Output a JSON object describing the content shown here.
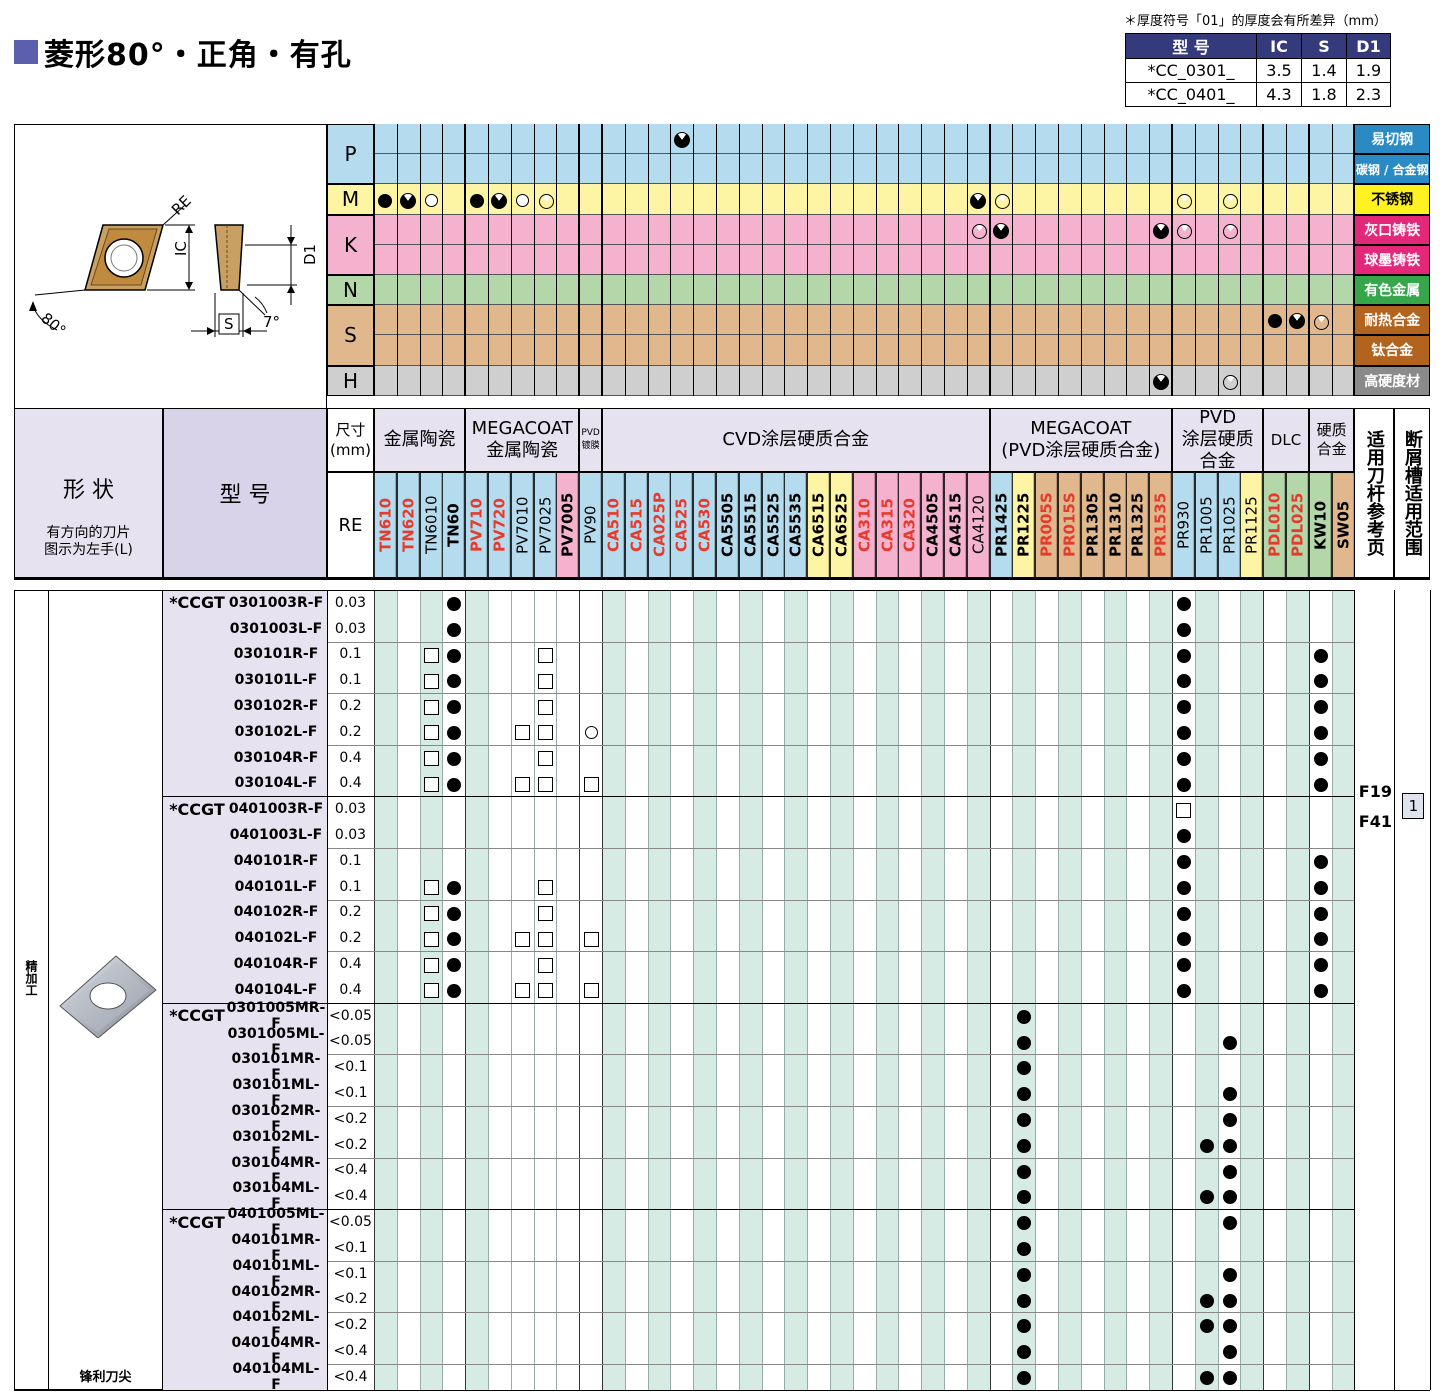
{
  "title": "菱形80°・正角・有孔",
  "note": "＊厚度符号「01」的厚度会有所差异（mm）",
  "dims_table": {
    "headers": [
      "型 号",
      "IC",
      "S",
      "D1"
    ],
    "rows": [
      [
        "*CC_0301_",
        "3.5",
        "1.4",
        "1.9"
      ],
      [
        "*CC_0401_",
        "4.3",
        "1.8",
        "2.3"
      ]
    ]
  },
  "diagram_labels": {
    "re": "RE",
    "ic": "IC",
    "d1": "D1",
    "s": "S",
    "angle80": "80°",
    "angle7": "7°"
  },
  "materials": [
    {
      "code": "P",
      "color": "#b5dcee",
      "rows": [
        {
          "name": "易切钢",
          "bg": "#2a8ac4"
        },
        {
          "name": "碳钢 / 合金钢",
          "bg": "#2a8ac4"
        }
      ]
    },
    {
      "code": "M",
      "color": "#fdf5a4",
      "rows": [
        {
          "name": "不锈钢",
          "bg": "#fff220"
        }
      ]
    },
    {
      "code": "K",
      "color": "#f4b2cf",
      "rows": [
        {
          "name": "灰口铸铁",
          "bg": "#e3287a"
        },
        {
          "name": "球墨铸铁",
          "bg": "#e3287a"
        }
      ]
    },
    {
      "code": "N",
      "color": "#b4d7aa",
      "rows": [
        {
          "name": "有色金属",
          "bg": "#36a64a"
        }
      ]
    },
    {
      "code": "S",
      "color": "#e1b88e",
      "rows": [
        {
          "name": "耐热合金",
          "bg": "#b2641f"
        },
        {
          "name": "钛合金",
          "bg": "#b2641f"
        }
      ]
    },
    {
      "code": "H",
      "color": "#cfcfcf",
      "rows": [
        {
          "name": "高硬度材",
          "bg": "#8a8a8a"
        }
      ]
    }
  ],
  "material_marks": [
    [
      [
        [
          "N",
          "pac"
        ]
      ]
    ],
    [
      [
        [
          "A",
          "dot"
        ],
        [
          "B",
          "pac"
        ],
        [
          "C",
          "circle"
        ],
        [
          "E",
          "dot"
        ],
        [
          "F",
          "pac"
        ],
        [
          "G",
          "circle"
        ],
        [
          "H",
          "thin"
        ],
        [
          "AA",
          "pac"
        ],
        [
          "AB",
          "thin"
        ],
        [
          "AJ",
          "thin"
        ],
        [
          "AL",
          "thin"
        ]
      ]
    ],
    [
      [
        [
          "AA",
          "thin"
        ],
        [
          "AB",
          "pac"
        ],
        [
          "AI",
          "pac"
        ],
        [
          "AJ",
          "thin"
        ],
        [
          "AL",
          "thin"
        ]
      ]
    ],
    [
      [],
      []
    ],
    [
      [
        [
          "AN",
          "dot"
        ],
        [
          "AO",
          "pac"
        ],
        [
          "AP",
          "thin"
        ]
      ]
    ],
    [
      [
        [
          "AI",
          "pac"
        ],
        [
          "AL",
          "thin"
        ]
      ],
      [
        [
          "AI",
          "pac"
        ],
        [
          "AP",
          "thin"
        ]
      ]
    ],
    [
      []
    ]
  ],
  "headers": {
    "shape": "形 状",
    "shape_note": "有方向的刀片\n图示为左手(L)",
    "model": "型 号",
    "size": "尺寸\n(mm)",
    "re": "RE",
    "holder_pages": "适用刀杆参考页",
    "breaker_range": "断屑槽适用范围"
  },
  "groups": [
    {
      "label": "金属陶瓷",
      "cols": 4
    },
    {
      "label": "MEGACOAT\n金属陶瓷",
      "cols": 5
    },
    {
      "label": "PVD\n镀膜",
      "cols": 1
    },
    {
      "label": "CVD涂层硬质合金",
      "cols": 17
    },
    {
      "label": "MEGACOAT\n(PVD涂层硬质合金)",
      "cols": 8
    },
    {
      "label": "PVD\n涂层硬质合金",
      "cols": 4
    },
    {
      "label": "DLC",
      "cols": 2
    },
    {
      "label": "硬质\n合金",
      "cols": 2
    }
  ],
  "grades": [
    {
      "name": "TN610",
      "color": "#e63a2c",
      "bg": "#b5dcee"
    },
    {
      "name": "TN620",
      "color": "#e63a2c",
      "bg": "#b5dcee"
    },
    {
      "name": "TN6010",
      "color": "#000",
      "bg": "#b5dcee",
      "normal": true
    },
    {
      "name": "TN60",
      "color": "#000",
      "bg": "#b5dcee"
    },
    {
      "name": "PV710",
      "color": "#e63a2c",
      "bg": "#b5dcee"
    },
    {
      "name": "PV720",
      "color": "#e63a2c",
      "bg": "#b5dcee"
    },
    {
      "name": "PV7010",
      "color": "#000",
      "bg": "#b5dcee",
      "normal": true
    },
    {
      "name": "PV7025",
      "color": "#000",
      "bg": "#b5dcee",
      "normal": true
    },
    {
      "name": "PV7005",
      "color": "#000",
      "bg": "#f4b2cf"
    },
    {
      "name": "PV90",
      "color": "#000",
      "bg": "#b5dcee",
      "normal": true
    },
    {
      "name": "CA510",
      "color": "#e63a2c",
      "bg": "#b5dcee"
    },
    {
      "name": "CA515",
      "color": "#e63a2c",
      "bg": "#b5dcee"
    },
    {
      "name": "CA025P",
      "color": "#e63a2c",
      "bg": "#b5dcee"
    },
    {
      "name": "CA525",
      "color": "#e63a2c",
      "bg": "#b5dcee"
    },
    {
      "name": "CA530",
      "color": "#e63a2c",
      "bg": "#b5dcee"
    },
    {
      "name": "CA5505",
      "color": "#000",
      "bg": "#b5dcee"
    },
    {
      "name": "CA5515",
      "color": "#000",
      "bg": "#b5dcee"
    },
    {
      "name": "CA5525",
      "color": "#000",
      "bg": "#b5dcee"
    },
    {
      "name": "CA5535",
      "color": "#000",
      "bg": "#b5dcee"
    },
    {
      "name": "CA6515",
      "color": "#000",
      "bg": "#fdf5a4"
    },
    {
      "name": "CA6525",
      "color": "#000",
      "bg": "#fdf5a4"
    },
    {
      "name": "CA310",
      "color": "#e63a2c",
      "bg": "#f4b2cf"
    },
    {
      "name": "CA315",
      "color": "#e63a2c",
      "bg": "#f4b2cf"
    },
    {
      "name": "CA320",
      "color": "#e63a2c",
      "bg": "#f4b2cf"
    },
    {
      "name": "CA4505",
      "color": "#000",
      "bg": "#f4b2cf"
    },
    {
      "name": "CA4515",
      "color": "#000",
      "bg": "#f4b2cf"
    },
    {
      "name": "CA4120",
      "color": "#000",
      "bg": "#f4b2cf",
      "normal": true
    },
    {
      "name": "PR1425",
      "color": "#000",
      "bg": "#b5dcee"
    },
    {
      "name": "PR1225",
      "color": "#000",
      "bg": "#fdf5a4"
    },
    {
      "name": "PR005S",
      "color": "#e63a2c",
      "bg": "#e1b88e"
    },
    {
      "name": "PR015S",
      "color": "#e63a2c",
      "bg": "#e1b88e"
    },
    {
      "name": "PR1305",
      "color": "#000",
      "bg": "#e1b88e"
    },
    {
      "name": "PR1310",
      "color": "#000",
      "bg": "#e1b88e"
    },
    {
      "name": "PR1325",
      "color": "#000",
      "bg": "#e1b88e"
    },
    {
      "name": "PR1535",
      "color": "#e63a2c",
      "bg": "#e1b88e"
    },
    {
      "name": "PR930",
      "color": "#000",
      "bg": "#b5dcee",
      "normal": true
    },
    {
      "name": "PR1005",
      "color": "#000",
      "bg": "#b5dcee",
      "normal": true
    },
    {
      "name": "PR1025",
      "color": "#000",
      "bg": "#b5dcee",
      "normal": true
    },
    {
      "name": "PR1125",
      "color": "#000",
      "bg": "#fdf5a4",
      "normal": true
    },
    {
      "name": "PDL010",
      "color": "#e63a2c",
      "bg": "#b4d7aa"
    },
    {
      "name": "PDL025",
      "color": "#e63a2c",
      "bg": "#b4d7aa"
    },
    {
      "name": "KW10",
      "color": "#000",
      "bg": "#b4d7aa"
    },
    {
      "name": "SW05",
      "color": "#000",
      "bg": "#e1b88e"
    }
  ],
  "body": {
    "category": "精加工",
    "shape_caption": "锋利刀尖",
    "holder_pages": [
      "F19",
      "F41"
    ],
    "breaker_range": "1",
    "rows": [
      {
        "prefix": "*CCGT",
        "model": "0301003R-F",
        "re": "0.03",
        "marks": [
          [
            "D",
            "dot"
          ],
          [
            "AJ",
            "dot"
          ]
        ]
      },
      {
        "model": "0301003L-F",
        "re": "0.03",
        "marks": [
          [
            "D",
            "dot"
          ],
          [
            "AJ",
            "dot"
          ]
        ]
      },
      {
        "model": "030101R-F",
        "re": "0.1",
        "marks": [
          [
            "C",
            "square"
          ],
          [
            "D",
            "dot"
          ],
          [
            "H",
            "square"
          ],
          [
            "AJ",
            "dot"
          ],
          [
            "AP",
            "dot"
          ]
        ]
      },
      {
        "model": "030101L-F",
        "re": "0.1",
        "marks": [
          [
            "C",
            "square"
          ],
          [
            "D",
            "dot"
          ],
          [
            "H",
            "square"
          ],
          [
            "AJ",
            "dot"
          ],
          [
            "AP",
            "dot"
          ]
        ]
      },
      {
        "model": "030102R-F",
        "re": "0.2",
        "marks": [
          [
            "C",
            "square"
          ],
          [
            "D",
            "dot"
          ],
          [
            "H",
            "square"
          ],
          [
            "AJ",
            "dot"
          ],
          [
            "AP",
            "dot"
          ]
        ]
      },
      {
        "model": "030102L-F",
        "re": "0.2",
        "marks": [
          [
            "C",
            "square"
          ],
          [
            "D",
            "dot"
          ],
          [
            "G",
            "square"
          ],
          [
            "H",
            "square"
          ],
          [
            "J",
            "circle"
          ],
          [
            "AJ",
            "dot"
          ],
          [
            "AP",
            "dot"
          ]
        ]
      },
      {
        "model": "030104R-F",
        "re": "0.4",
        "marks": [
          [
            "C",
            "square"
          ],
          [
            "D",
            "dot"
          ],
          [
            "H",
            "square"
          ],
          [
            "AJ",
            "dot"
          ],
          [
            "AP",
            "dot"
          ]
        ]
      },
      {
        "model": "030104L-F",
        "re": "0.4",
        "marks": [
          [
            "C",
            "square"
          ],
          [
            "D",
            "dot"
          ],
          [
            "G",
            "square"
          ],
          [
            "H",
            "square"
          ],
          [
            "J",
            "square"
          ],
          [
            "AJ",
            "dot"
          ],
          [
            "AP",
            "dot"
          ]
        ]
      },
      {
        "prefix": "*CCGT",
        "model": "0401003R-F",
        "re": "0.03",
        "marks": [
          [
            "AJ",
            "square"
          ]
        ]
      },
      {
        "model": "0401003L-F",
        "re": "0.03",
        "marks": [
          [
            "AJ",
            "dot"
          ]
        ]
      },
      {
        "model": "040101R-F",
        "re": "0.1",
        "marks": [
          [
            "AJ",
            "dot"
          ],
          [
            "AP",
            "dot"
          ]
        ]
      },
      {
        "model": "040101L-F",
        "re": "0.1",
        "marks": [
          [
            "C",
            "square"
          ],
          [
            "D",
            "dot"
          ],
          [
            "H",
            "square"
          ],
          [
            "AJ",
            "dot"
          ],
          [
            "AP",
            "dot"
          ]
        ]
      },
      {
        "model": "040102R-F",
        "re": "0.2",
        "marks": [
          [
            "C",
            "square"
          ],
          [
            "D",
            "dot"
          ],
          [
            "H",
            "square"
          ],
          [
            "AJ",
            "dot"
          ],
          [
            "AP",
            "dot"
          ]
        ]
      },
      {
        "model": "040102L-F",
        "re": "0.2",
        "marks": [
          [
            "C",
            "square"
          ],
          [
            "D",
            "dot"
          ],
          [
            "G",
            "square"
          ],
          [
            "H",
            "square"
          ],
          [
            "J",
            "square"
          ],
          [
            "AJ",
            "dot"
          ],
          [
            "AP",
            "dot"
          ]
        ]
      },
      {
        "model": "040104R-F",
        "re": "0.4",
        "marks": [
          [
            "C",
            "square"
          ],
          [
            "D",
            "dot"
          ],
          [
            "H",
            "square"
          ],
          [
            "AJ",
            "dot"
          ],
          [
            "AP",
            "dot"
          ]
        ]
      },
      {
        "model": "040104L-F",
        "re": "0.4",
        "marks": [
          [
            "C",
            "square"
          ],
          [
            "D",
            "dot"
          ],
          [
            "G",
            "square"
          ],
          [
            "H",
            "square"
          ],
          [
            "J",
            "square"
          ],
          [
            "AJ",
            "dot"
          ],
          [
            "AP",
            "dot"
          ]
        ]
      },
      {
        "prefix": "*CCGT",
        "model": "0301005MR-F",
        "re": "<0.05",
        "marks": [
          [
            "AC",
            "dot"
          ]
        ]
      },
      {
        "model": "0301005ML-F",
        "re": "<0.05",
        "marks": [
          [
            "AC",
            "dot"
          ],
          [
            "AL",
            "dot"
          ]
        ]
      },
      {
        "model": "030101MR-F",
        "re": "<0.1",
        "marks": [
          [
            "AC",
            "dot"
          ]
        ]
      },
      {
        "model": "030101ML-F",
        "re": "<0.1",
        "marks": [
          [
            "AC",
            "dot"
          ],
          [
            "AL",
            "dot"
          ]
        ]
      },
      {
        "model": "030102MR-F",
        "re": "<0.2",
        "marks": [
          [
            "AC",
            "dot"
          ],
          [
            "AL",
            "dot"
          ]
        ]
      },
      {
        "model": "030102ML-F",
        "re": "<0.2",
        "marks": [
          [
            "AC",
            "dot"
          ],
          [
            "AK",
            "dot"
          ],
          [
            "AL",
            "dot"
          ]
        ]
      },
      {
        "model": "030104MR-F",
        "re": "<0.4",
        "marks": [
          [
            "AC",
            "dot"
          ],
          [
            "AL",
            "dot"
          ]
        ]
      },
      {
        "model": "030104ML-F",
        "re": "<0.4",
        "marks": [
          [
            "AC",
            "dot"
          ],
          [
            "AK",
            "dot"
          ],
          [
            "AL",
            "dot"
          ]
        ]
      },
      {
        "prefix": "*CCGT",
        "model": "0401005ML-F",
        "re": "<0.05",
        "marks": [
          [
            "AC",
            "dot"
          ],
          [
            "AL",
            "dot"
          ]
        ]
      },
      {
        "model": "040101MR-F",
        "re": "<0.1",
        "marks": [
          [
            "AC",
            "dot"
          ]
        ]
      },
      {
        "model": "040101ML-F",
        "re": "<0.1",
        "marks": [
          [
            "AC",
            "dot"
          ],
          [
            "AL",
            "dot"
          ]
        ]
      },
      {
        "model": "040102MR-F",
        "re": "<0.2",
        "marks": [
          [
            "AC",
            "dot"
          ],
          [
            "AK",
            "dot"
          ],
          [
            "AL",
            "dot"
          ]
        ]
      },
      {
        "model": "040102ML-F",
        "re": "<0.2",
        "marks": [
          [
            "AC",
            "dot"
          ],
          [
            "AK",
            "dot"
          ],
          [
            "AL",
            "dot"
          ]
        ]
      },
      {
        "model": "040104MR-F",
        "re": "<0.4",
        "marks": [
          [
            "AC",
            "dot"
          ],
          [
            "AL",
            "dot"
          ]
        ]
      },
      {
        "model": "040104ML-F",
        "re": "<0.4",
        "marks": [
          [
            "AC",
            "dot"
          ],
          [
            "AK",
            "dot"
          ],
          [
            "AL",
            "dot"
          ]
        ]
      }
    ]
  }
}
